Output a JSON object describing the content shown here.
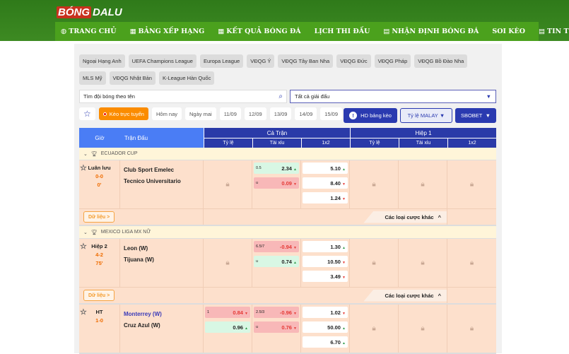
{
  "brand": {
    "logo_text": "BONGDALU"
  },
  "nav": [
    {
      "icon": "globe-icon",
      "glyph": "◍",
      "label": "TRANG CHỦ"
    },
    {
      "icon": "calendar-icon",
      "glyph": "▦",
      "label": "BẢNG XẾP HẠNG"
    },
    {
      "icon": "calendar-icon",
      "glyph": "▦",
      "label": "KẾT QUẢ BÓNG ĐÁ"
    },
    {
      "icon": "",
      "glyph": "",
      "label": "LỊCH THI ĐẤU"
    },
    {
      "icon": "calculator-icon",
      "glyph": "▤",
      "label": "NHẬN ĐỊNH BÓNG ĐÁ"
    },
    {
      "icon": "",
      "glyph": "",
      "label": "SOI KÈO"
    },
    {
      "icon": "news-icon",
      "glyph": "▤",
      "label": "TIN TỨC"
    }
  ],
  "leagues": [
    "Ngoại Hạng Anh",
    "UEFA Champions League",
    "Europa League",
    "VĐQG Ý",
    "VĐQG Tây Ban Nha",
    "VĐQG Đức",
    "VĐQG Pháp",
    "VĐQG Bồ Đào Nha",
    "MLS Mỹ",
    "VĐQG Nhật Bản",
    "K-League Hàn Quốc"
  ],
  "search": {
    "placeholder": "Tìm đội bóng theo tên"
  },
  "league_select": {
    "value": "Tất cả giải đấu"
  },
  "filters": {
    "live": "Kèo trực tuyến",
    "dates": [
      "Hôm nay",
      "Ngày mai",
      "11/09",
      "12/09",
      "13/09",
      "14/09",
      "15/09"
    ]
  },
  "buttons": {
    "guide": "HD bảng kèo",
    "odds_type": "Tỷ lệ MALAY",
    "bookmaker": "SBOBET"
  },
  "table": {
    "col_time": "Giờ",
    "col_match": "Trận Đấu",
    "full": "Cả Trận",
    "half": "Hiệp 1",
    "sub": [
      "Tỷ lệ",
      "Tài xỉu",
      "1x2"
    ]
  },
  "labels": {
    "data": "Dữ liệu >",
    "more": "Các loại cược khác"
  },
  "colors": {
    "header_green": "#3d8a22",
    "nav_green": "#4ba11d",
    "table_blue": "#2a3aa8",
    "live_orange": "#fb8c00",
    "row_bg": "#fde0cc"
  },
  "groups": [
    {
      "league": "ECUADOR CUP",
      "matches": [
        {
          "state": "Luân lưu",
          "score": "0-0",
          "minute": "0'",
          "home": "Club Sport Emelec",
          "away": "Tecnico Universitario",
          "home_highlight": false,
          "ft_hdp": null,
          "ft_ou": [
            {
              "label": "0.5",
              "value": "2.34",
              "dir": "up",
              "bg": "green"
            },
            {
              "label": "u",
              "value": "0.09",
              "dir": "down",
              "bg": "red"
            }
          ],
          "ft_1x2": [
            {
              "value": "5.10",
              "dir": "up"
            },
            {
              "value": "8.40",
              "dir": "down"
            },
            {
              "value": "1.24",
              "dir": "down"
            }
          ],
          "h1_locked": true,
          "footer": true
        }
      ]
    },
    {
      "league": "MEXICO LIGA MX NỮ",
      "matches": [
        {
          "state": "Hiệp 2",
          "score": "4-2",
          "minute": "75'",
          "home": "Leon (W)",
          "away": "Tijuana (W)",
          "home_highlight": false,
          "ft_hdp": null,
          "ft_ou": [
            {
              "label": "6.5/7",
              "value": "-0.94",
              "dir": "down",
              "bg": "red"
            },
            {
              "label": "u",
              "value": "0.74",
              "dir": "up",
              "bg": "green"
            }
          ],
          "ft_1x2": [
            {
              "value": "1.30",
              "dir": "up"
            },
            {
              "value": "10.50",
              "dir": "down"
            },
            {
              "value": "3.49",
              "dir": "down"
            }
          ],
          "h1_locked": true,
          "footer": true
        },
        {
          "state": "HT",
          "score": "1-0",
          "minute": "",
          "home": "Monterrey (W)",
          "away": "Cruz Azul (W)",
          "home_highlight": true,
          "ft_hdp": [
            {
              "label": "1",
              "value": "0.84",
              "dir": "down",
              "bg": "red"
            },
            {
              "label": "",
              "value": "0.96",
              "dir": "up",
              "bg": "green"
            }
          ],
          "ft_ou": [
            {
              "label": "2.5/3",
              "value": "-0.96",
              "dir": "down",
              "bg": "red"
            },
            {
              "label": "u",
              "value": "0.76",
              "dir": "down",
              "bg": "red"
            }
          ],
          "ft_1x2": [
            {
              "value": "1.02",
              "dir": "down"
            },
            {
              "value": "50.00",
              "dir": "up"
            },
            {
              "value": "6.70",
              "dir": "up"
            }
          ],
          "h1_locked": true,
          "footer": false
        }
      ]
    }
  ]
}
